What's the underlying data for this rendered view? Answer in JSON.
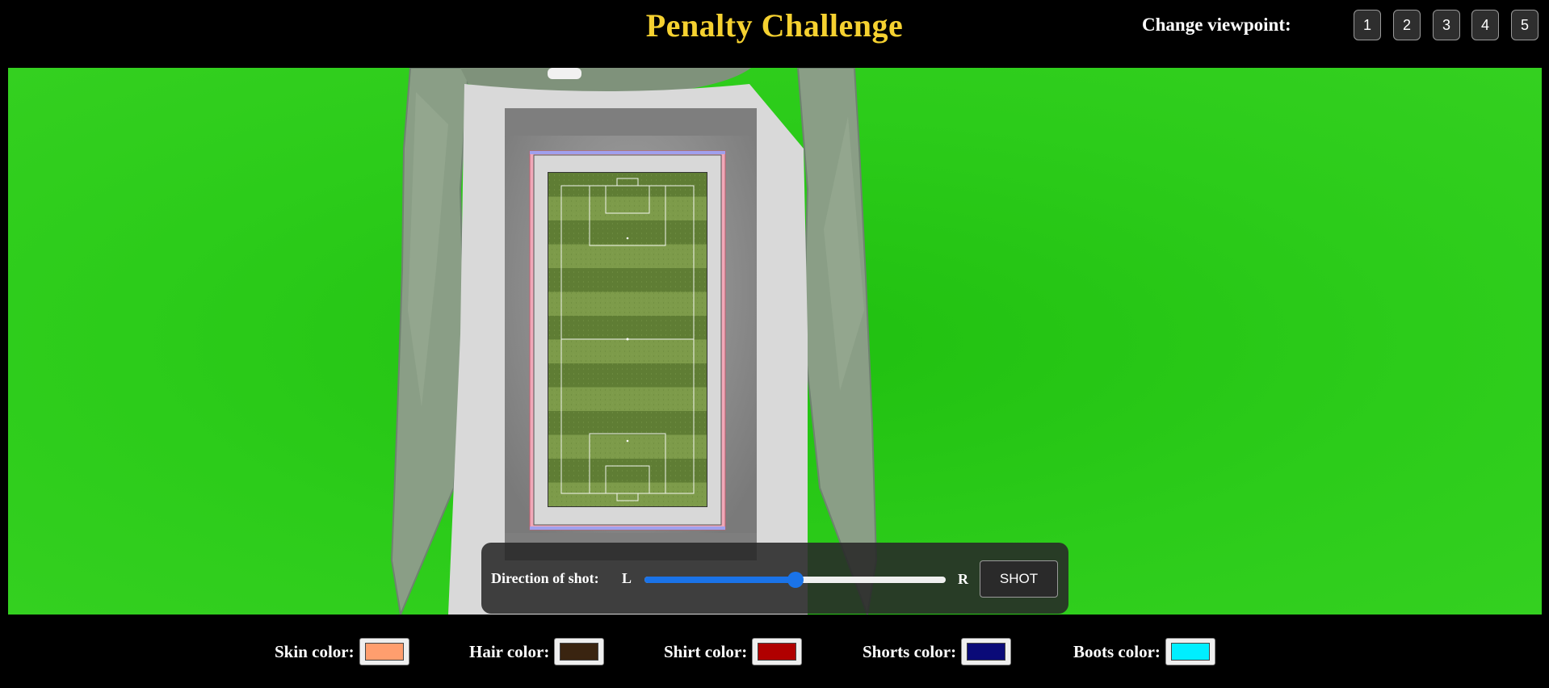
{
  "header": {
    "title": "Penalty Challenge",
    "viewpoint_label": "Change viewpoint:",
    "viewpoint_buttons": [
      "1",
      "2",
      "3",
      "4",
      "5"
    ]
  },
  "controls": {
    "direction_label": "Direction of shot:",
    "left_label": "L",
    "right_label": "R",
    "direction_value": 0.5,
    "shot_label": "SHOT"
  },
  "colors": {
    "skin": {
      "label": "Skin color:",
      "value": "#ff9e6e"
    },
    "hair": {
      "label": "Hair color:",
      "value": "#3a2410"
    },
    "shirt": {
      "label": "Shirt color:",
      "value": "#b00000"
    },
    "shorts": {
      "label": "Shorts color:",
      "value": "#0a0a78"
    },
    "boots": {
      "label": "Boots color:",
      "value": "#00eeff"
    }
  },
  "theme": {
    "title_color": "#f5d130",
    "scene_green": "#2ccc1a",
    "slider_accent": "#1a73e8"
  }
}
